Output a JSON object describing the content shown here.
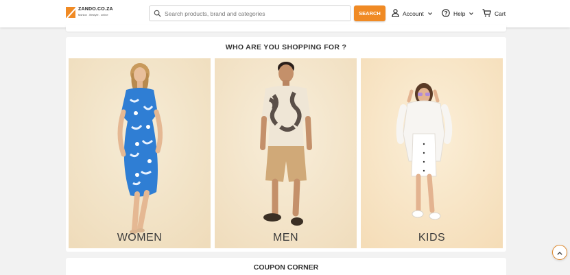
{
  "header": {
    "logo": {
      "name": "ZANDO.CO.ZA",
      "tagline": "fashion . lifestyle . online"
    },
    "search": {
      "placeholder": "Search products, brand and categories",
      "value": "",
      "button_label": "SEARCH"
    },
    "nav": {
      "account": "Account",
      "help": "Help",
      "cart": "Cart"
    }
  },
  "shopping_section": {
    "title": "WHO ARE YOU SHOPPING FOR ?",
    "cards": [
      {
        "label": "WOMEN"
      },
      {
        "label": "MEN"
      },
      {
        "label": "KIDS"
      }
    ]
  },
  "coupon_section": {
    "title": "COUPON CORNER"
  },
  "colors": {
    "accent": "#f08a24",
    "page_bg": "#f2f2f2",
    "card_bg": "#f3e6cc"
  },
  "icons": [
    "search-icon",
    "user-icon",
    "help-icon",
    "cart-icon",
    "chevron-down-icon",
    "chevron-up-icon"
  ]
}
